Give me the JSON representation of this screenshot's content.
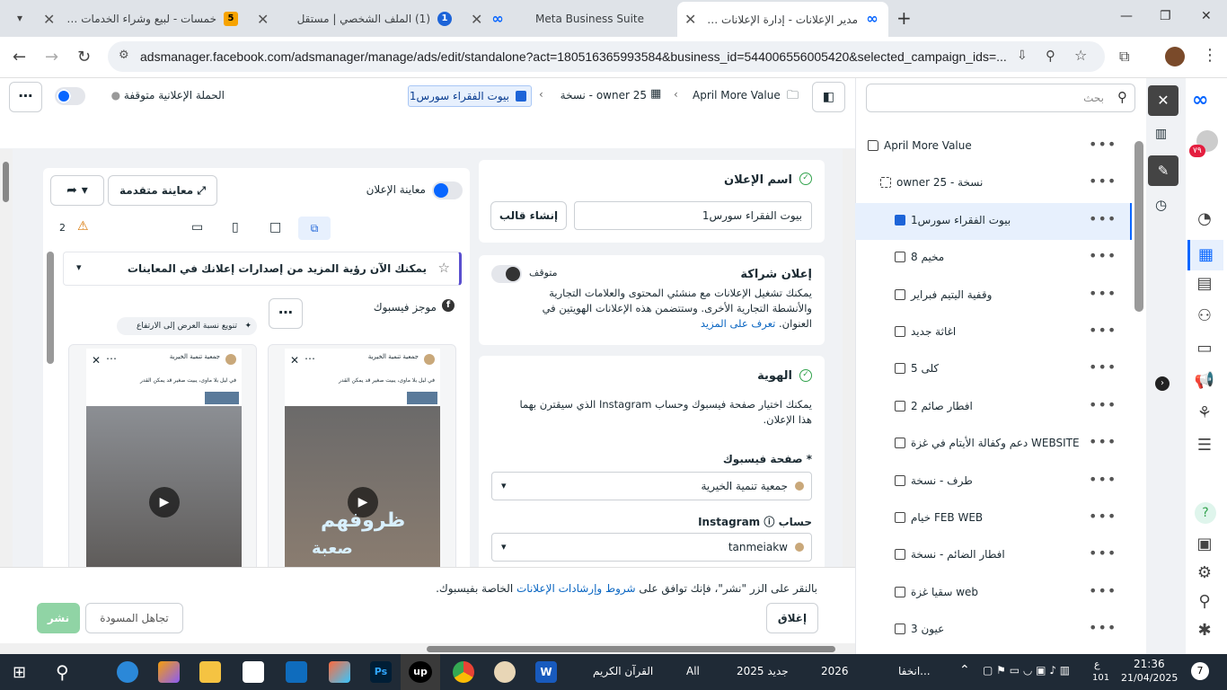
{
  "browser": {
    "tabs": [
      {
        "title": "خمسات - لبيع وشراء الخدمات المص",
        "fav": "5",
        "fav_color": "#f7a300"
      },
      {
        "title": "(1) الملف الشخصي | مستقل",
        "fav": "1",
        "fav_color": "#1d64d8"
      },
      {
        "title": "Meta Business Suite",
        "fav": "∞",
        "fav_color": "#0866ff"
      },
      {
        "title": "مدير الإعلانات - إدارة الإعلانات - ال",
        "fav": "∞",
        "fav_color": "#0866ff"
      }
    ],
    "url": "adsmanager.facebook.com/adsmanager/manage/ads/edit/standalone?act=180516365993584&business_id=544006556005420&selected_campaign_ids=..."
  },
  "header": {
    "campaign_status": "الحملة الإعلانية متوقفة",
    "breadcrumb": {
      "campaign": "April More Value",
      "adset": "owner 25 - نسخة",
      "ad": "بيوت الفقراء سورس1"
    }
  },
  "preview": {
    "toggle_label": "معاينة الإعلان",
    "advanced_label": "معاينة متقدمة",
    "warning_count": "2",
    "notice": "يمكنك الآن رؤية المزيد من إصدارات إعلانك في المعاينات",
    "placement": "موجز فيسبوك",
    "ratio_label": "تنويع نسبة العرض إلى الارتفاع",
    "card_page": "جمعية تنمية الخيرية",
    "card_line1": "في ليل بلا مأوى، يبيت صغير قد يمكن القدر",
    "card_line2": "ظروفهم",
    "card_line3": "صعبة"
  },
  "editor": {
    "ad_name_title": "اسم الإعلان",
    "ad_name_value": "بيوت الفقراء سورس1",
    "create_template": "إنشاء قالب",
    "partner_title": "إعلان شراكة",
    "partner_status": "متوقف",
    "partner_desc": "يمكنك تشغيل الإعلانات مع منشئي المحتوى والعلامات التجارية والأنشطة التجارية الأخرى. وستتضمن هذه الإعلانات الهويتين في العنوان.",
    "learn_more": "تعرف على المزيد",
    "identity_title": "الهوية",
    "identity_desc": "يمكنك اختيار صفحة فيسبوك وحساب Instagram الذي سيقترن بهما هذا الإعلان.",
    "fb_page_label": "* صفحة فيسبوك",
    "fb_page_value": "جمعية تنمية الخيرية",
    "ig_label": "حساب Instagram",
    "ig_value": "tanmeiakw"
  },
  "footer": {
    "terms_prefix": "بالنقر على الزر \"نشر\"، فإنك توافق على",
    "terms_link": "شروط وإرشادات الإعلانات",
    "terms_suffix": "الخاصة بفيسبوك.",
    "close": "إغلاق",
    "discard": "تجاهل المسودة",
    "publish": "نشر"
  },
  "sidebar": {
    "search_placeholder": "بحث",
    "items": [
      {
        "label": "April More Value",
        "level": 0
      },
      {
        "label": "owner 25 - نسخة",
        "level": 1
      },
      {
        "label": "بيوت الفقراء سورس1",
        "level": 2,
        "selected": true
      },
      {
        "label": "مخيم 8",
        "level": 2
      },
      {
        "label": "وقفية اليتيم فبراير",
        "level": 2
      },
      {
        "label": "اغاثة جديد",
        "level": 2
      },
      {
        "label": "كلى 5",
        "level": 2
      },
      {
        "label": "افطار صائم 2",
        "level": 2
      },
      {
        "label": "دعم وكفالة الأيتام في غزة WEBSITE",
        "level": 2
      },
      {
        "label": "طرف - نسخة",
        "level": 2
      },
      {
        "label": "خيام FEB WEB",
        "level": 2
      },
      {
        "label": "افطار الضائم - نسخة",
        "level": 2
      },
      {
        "label": "سقيا غزة web",
        "level": 2
      },
      {
        "label": "عيون 3",
        "level": 2
      }
    ]
  },
  "rail": {
    "badge": "٧٩"
  },
  "taskbar": {
    "items": [
      "القرآن الكريم",
      "All",
      "جديد 2025",
      "2026",
      "انخفا..."
    ],
    "lang": "ع",
    "lang_sub": "101",
    "time": "21:36",
    "date": "21/04/2025",
    "notif": "7"
  },
  "colors": {
    "accent": "#0866ff",
    "selected_bg": "#e7f0fd",
    "panel_bg": "#f0f2f5",
    "publish_bg": "#90d4a5"
  }
}
